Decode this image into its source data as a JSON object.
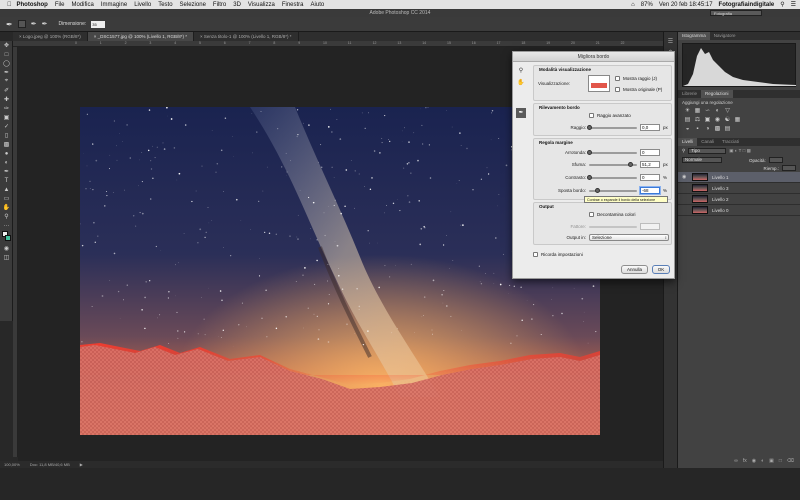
{
  "menubar": {
    "app": "Photoshop",
    "items": [
      "File",
      "Modifica",
      "Immagine",
      "Livello",
      "Testo",
      "Selezione",
      "Filtro",
      "3D",
      "Visualizza",
      "Finestra",
      "Aiuto"
    ],
    "battery": "87%",
    "clock": "Ven 20 feb  18:45:17",
    "user": "Fotografiaindigitale"
  },
  "apptitle": {
    "title": "Adobe Photoshop CC 2014",
    "workspace": "Fotografia"
  },
  "options": {
    "size_label": "Dimensione:",
    "size_value": "35"
  },
  "tabs": [
    {
      "label": "Logo.jpeg @ 100% (RGB/8*)"
    },
    {
      "label": "_DSC1577.jpg @ 100% (Livello 1, RGB/8*) *"
    },
    {
      "label": "Senza titolo-1 @ 100% (Livello 1, RGB/8*) *"
    }
  ],
  "ruler": [
    "0",
    "1",
    "2",
    "3",
    "4",
    "5",
    "6",
    "7",
    "8",
    "9",
    "10",
    "11",
    "12",
    "13",
    "14",
    "15",
    "16",
    "17",
    "18",
    "19",
    "20",
    "21",
    "22"
  ],
  "status": {
    "zoom": "100,00%",
    "doc": "Doc: 11,8 MB/40,6 MB"
  },
  "panels": {
    "top_tabs": [
      "Istogramma",
      "Navigatore"
    ],
    "mid_tabs": [
      "Librerie",
      "Regolazioni"
    ],
    "adj_title": "Aggiungi una regolazione",
    "layer_tabs": [
      "Livelli",
      "Canali",
      "Tracciati"
    ],
    "kind": "Tipo",
    "blend": "Normale",
    "opacity_label": "Opacità:",
    "fill_label": "Riemp.:",
    "layers": [
      "Livello 1",
      "Livello 3",
      "Livello 2",
      "Livello 0"
    ]
  },
  "dialog": {
    "title": "Migliora bordo",
    "view_mode": {
      "title": "Modalità visualizzazione",
      "view_label": "Visualizzazione:",
      "show_radius": "Mostra raggio (J)",
      "show_original": "Mostra originale (P)"
    },
    "edge_detection": {
      "title": "Rilevamento bordo",
      "smart_radius": "Raggio avanzato",
      "radius_label": "Raggio:",
      "radius_value": "0,0",
      "radius_unit": "px",
      "radius_level": 0
    },
    "adjust_edge": {
      "title": "Regola margine",
      "rows": [
        {
          "label": "Arrotonda:",
          "value": "0",
          "unit": "",
          "level": 0
        },
        {
          "label": "Sfuma:",
          "value": "51,2",
          "unit": "px",
          "level": 0.85
        },
        {
          "label": "Contrasto:",
          "value": "0",
          "unit": "%",
          "level": 0
        },
        {
          "label": "Sposta bordo:",
          "value": "-68",
          "unit": "%",
          "level": 0.16
        }
      ]
    },
    "output": {
      "title": "Output",
      "decontaminate": "Decontamina colori",
      "amount_label": "Fattore:",
      "output_to_label": "Output in:",
      "output_to_value": "Selezione"
    },
    "remember": "Ricorda impostazioni",
    "cancel": "Annulla",
    "ok": "OK",
    "tooltip": "Contrae o espande il bordo della selezione"
  },
  "colors": {
    "accent": "#3b7ad9",
    "overlay": "#e2564a"
  }
}
